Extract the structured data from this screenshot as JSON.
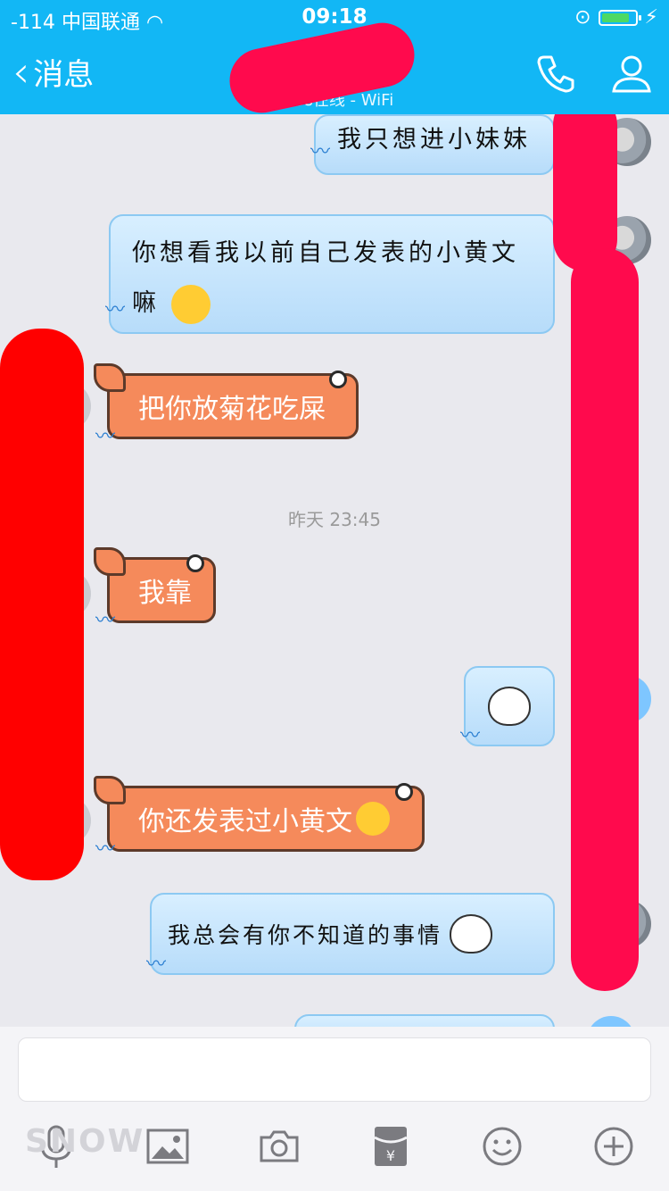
{
  "status_bar": {
    "signal": "-114",
    "carrier": "中国联通",
    "time": "09:18"
  },
  "nav": {
    "back_label": "消息",
    "subtitle": "5s在线 - WiFi"
  },
  "messages": [
    {
      "side": "right",
      "text": "我只想进小妹妹"
    },
    {
      "side": "right",
      "text": "你想看我以前自己发表的小黄文",
      "line2": "嘛"
    },
    {
      "side": "left",
      "text": "把你放菊花吃屎"
    },
    {
      "side": "left",
      "text": "我靠"
    },
    {
      "side": "left",
      "text": "你还发表过小黄文"
    },
    {
      "side": "right",
      "text": "我总会有你不知道的事情"
    }
  ],
  "timestamp": "昨天 23:45",
  "watermark": "SNOW",
  "colors": {
    "header": "#12b7f5",
    "redact_pink": "#ff0a4d",
    "redact_red": "#ff0000"
  },
  "icons": [
    "phone-icon",
    "profile-icon",
    "voice-icon",
    "image-icon",
    "camera-icon",
    "red-packet-icon",
    "emoji-icon",
    "plus-icon"
  ]
}
